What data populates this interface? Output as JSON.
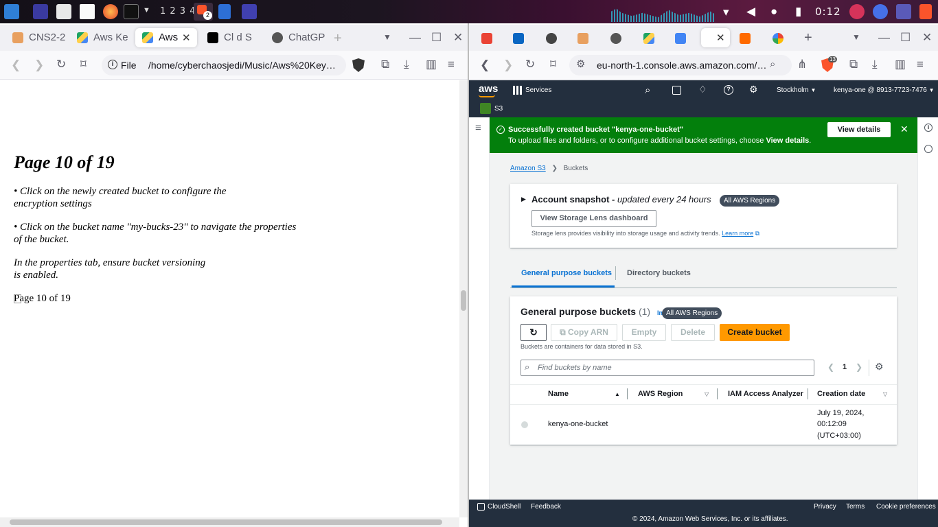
{
  "taskbar": {
    "workspaces": "1 2 3 4",
    "clock": "0:12",
    "brave_badge": "2"
  },
  "left_browser": {
    "tabs": [
      {
        "label": "CNS2-2"
      },
      {
        "label": "Aws Ke"
      },
      {
        "label": "Aws"
      },
      {
        "label": "Cl  d S"
      },
      {
        "label": "ChatGP"
      }
    ],
    "url_prefix": "File",
    "url": "/home/cyberchaosjedi/Music/Aws%20Key…"
  },
  "document": {
    "heading": "Page 10 of 19",
    "para1_line1": "• Click on the newly created bucket to configure the",
    "para1_line2": "encryption settings",
    "para2_line1": "• Click on the bucket name \"my-bucks-23\" to navigate the properties",
    "para2_line2": "of the bucket.",
    "para3_line1": "In the properties tab, ensure bucket versioning",
    "para3_line2": "is enabled.",
    "image_alt": "Page 10 of 19"
  },
  "right_browser": {
    "url": "eu-north-1.console.aws.amazon.com/…",
    "brave_count": "13"
  },
  "aws": {
    "logo": "aws",
    "services": "Services",
    "region": "Stockholm",
    "account": "kenya-one @ 8913-7723-7476",
    "service_chip": "S3",
    "banner_title": "Successfully created bucket \"kenya-one-bucket\"",
    "banner_text_pre": "To upload files and folders, or to configure additional bucket settings, choose ",
    "banner_text_bold": "View details",
    "banner_text_post": ".",
    "view_details": "View details",
    "breadcrumb_root": "Amazon S3",
    "breadcrumb_current": "Buckets",
    "snapshot_title": "Account snapshot -",
    "snapshot_subtitle": "updated every 24 hours",
    "all_regions": "All AWS Regions",
    "storage_lens_btn": "View Storage Lens dashboard",
    "storage_lens_desc": "Storage lens provides visibility into storage usage and activity trends.",
    "learn_more": "Learn more",
    "tab_general": "General purpose buckets",
    "tab_directory": "Directory buckets",
    "table_title": "General purpose buckets",
    "table_count": "(1)",
    "info": "Info",
    "copy_arn": "Copy ARN",
    "empty": "Empty",
    "delete": "Delete",
    "create_bucket": "Create bucket",
    "table_desc": "Buckets are containers for data stored in S3.",
    "search_placeholder": "Find buckets by name",
    "page_number": "1",
    "columns": [
      "Name",
      "AWS Region",
      "IAM Access Analyzer",
      "Creation date"
    ],
    "rows": [
      {
        "name": "kenya-one-bucket",
        "region": "",
        "analyzer": "",
        "date_line1": "July 19, 2024,",
        "date_line2": "00:12:09",
        "date_line3": "(UTC+03:00)"
      }
    ],
    "footer_cloudshell": "CloudShell",
    "footer_feedback": "Feedback",
    "footer_privacy": "Privacy",
    "footer_terms": "Terms",
    "footer_cookies": "Cookie preferences",
    "copyright": "© 2024, Amazon Web Services, Inc. or its affiliates."
  },
  "colors": {
    "aws_nav": "#232f3e",
    "success_green": "#037f0c",
    "primary_orange": "#ff9900",
    "link_blue": "#0972d3"
  }
}
